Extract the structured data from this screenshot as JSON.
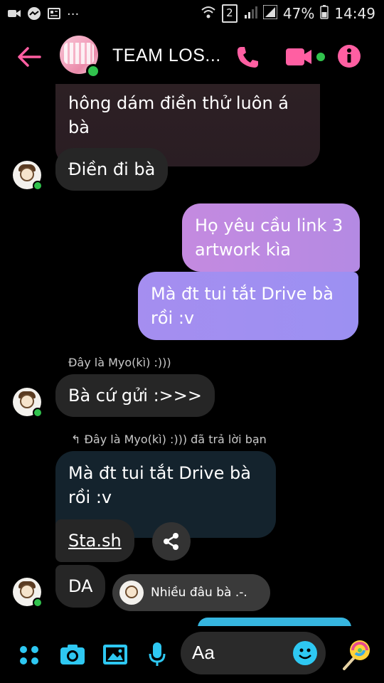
{
  "status_bar": {
    "left_icons": [
      "video-camera-icon",
      "messenger-icon",
      "newspaper-icon"
    ],
    "dots": "...",
    "sim": "2",
    "battery": "47%",
    "time": "14:49"
  },
  "header": {
    "title": "TEAM LOS...",
    "icons": [
      "back-arrow-icon",
      "phone-icon",
      "video-call-icon",
      "info-icon"
    ],
    "accent_color": "#ff5fa2"
  },
  "messages": {
    "m1": "hông dám điền thử luôn á bà",
    "m2": "Điền đi bà",
    "m3": "Họ yêu cầu link 3 artwork kìa",
    "m4": "Mà đt tui tắt Drive bà rồi :v",
    "sender": "Đây là Myo(kì) :)))",
    "m5": "Bà cứ gửi :>>>",
    "reply_header": "Đây là Myo(kì) :))) đã trả lời bạn",
    "m6_quoted": "Mà đt tui tắt Drive bà rồi :v",
    "m7": "Sta.sh",
    "m8": "DA",
    "reaction_preview": "Nhiều đâu bà .-."
  },
  "composer": {
    "placeholder": "Aa",
    "icons": [
      "apps-icon",
      "camera-icon",
      "image-icon",
      "mic-icon",
      "emoji-icon",
      "lollipop-icon"
    ],
    "accent_color": "#2ec8f2"
  }
}
